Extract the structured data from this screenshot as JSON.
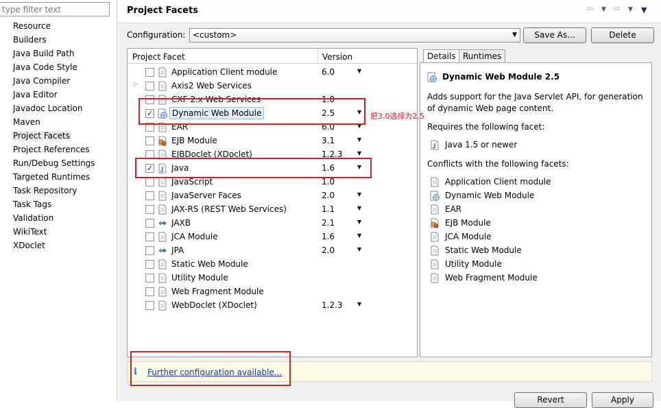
{
  "filter": {
    "placeholder": "type filter text"
  },
  "nav": {
    "items": [
      "Resource",
      "Builders",
      "Java Build Path",
      "Java Code Style",
      "Java Compiler",
      "Java Editor",
      "Javadoc Location",
      "Maven",
      "Project Facets",
      "Project References",
      "Run/Debug Settings",
      "Targeted Runtimes",
      "Task Repository",
      "Task Tags",
      "Validation",
      "WikiText",
      "XDoclet"
    ],
    "selected": "Project Facets"
  },
  "page": {
    "title": "Project Facets",
    "back_icon": "arrow-left-icon",
    "forward_icon": "arrow-right-icon"
  },
  "configuration": {
    "label": "Configuration:",
    "value": "<custom>",
    "save_as_label": "Save As...",
    "delete_label": "Delete"
  },
  "facets": {
    "headers": {
      "facet": "Project Facet",
      "version": "Version"
    },
    "rows": [
      {
        "name": "Application Client module",
        "version": "6.0",
        "checked": false,
        "icon": "page-icon",
        "dropdown": true,
        "expandable": false
      },
      {
        "name": "Axis2 Web Services",
        "version": "",
        "checked": false,
        "icon": "page-icon",
        "dropdown": false,
        "expandable": true
      },
      {
        "name": "CXF 2.x Web Services",
        "version": "1.0",
        "checked": false,
        "icon": "page-icon",
        "dropdown": false,
        "expandable": false
      },
      {
        "name": "Dynamic Web Module",
        "version": "2.5",
        "checked": true,
        "icon": "globe-page-icon",
        "dropdown": true,
        "expandable": false
      },
      {
        "name": "EAR",
        "version": "6.0",
        "checked": false,
        "icon": "page-icon",
        "dropdown": true,
        "expandable": false
      },
      {
        "name": "EJB Module",
        "version": "3.1",
        "checked": false,
        "icon": "bean-icon",
        "dropdown": true,
        "expandable": false
      },
      {
        "name": "EJBDoclet (XDoclet)",
        "version": "1.2.3",
        "checked": false,
        "icon": "page-icon",
        "dropdown": true,
        "expandable": false
      },
      {
        "name": "Java",
        "version": "1.6",
        "checked": true,
        "icon": "java-icon",
        "dropdown": true,
        "expandable": false
      },
      {
        "name": "JavaScript",
        "version": "1.0",
        "checked": false,
        "icon": "page-icon",
        "dropdown": false,
        "expandable": false
      },
      {
        "name": "JavaServer Faces",
        "version": "2.0",
        "checked": false,
        "icon": "page-icon",
        "dropdown": true,
        "expandable": false
      },
      {
        "name": "JAX-RS (REST Web Services)",
        "version": "1.1",
        "checked": false,
        "icon": "page-icon",
        "dropdown": true,
        "expandable": false
      },
      {
        "name": "JAXB",
        "version": "2.1",
        "checked": false,
        "icon": "arrows-icon",
        "dropdown": true,
        "expandable": false
      },
      {
        "name": "JCA Module",
        "version": "1.6",
        "checked": false,
        "icon": "page-icon",
        "dropdown": true,
        "expandable": false
      },
      {
        "name": "JPA",
        "version": "2.0",
        "checked": false,
        "icon": "arrows-icon",
        "dropdown": true,
        "expandable": false
      },
      {
        "name": "Static Web Module",
        "version": "",
        "checked": false,
        "icon": "page-icon",
        "dropdown": false,
        "expandable": false
      },
      {
        "name": "Utility Module",
        "version": "",
        "checked": false,
        "icon": "page-icon",
        "dropdown": false,
        "expandable": false
      },
      {
        "name": "Web Fragment Module",
        "version": "",
        "checked": false,
        "icon": "page-icon",
        "dropdown": false,
        "expandable": false
      },
      {
        "name": "WebDoclet (XDoclet)",
        "version": "1.2.3",
        "checked": false,
        "icon": "page-icon",
        "dropdown": true,
        "expandable": false
      }
    ]
  },
  "details": {
    "tabs": {
      "details": "Details",
      "runtimes": "Runtimes"
    },
    "title": "Dynamic Web Module 2.5",
    "description_line1": "Adds support for the Java Servlet API, for generation",
    "description_line2": "of dynamic Web page content.",
    "requires_label": "Requires the following facet:",
    "requires": [
      {
        "name": "Java 1.5 or newer",
        "icon": "java-icon"
      }
    ],
    "conflicts_label": "Conflicts with the following facets:",
    "conflicts": [
      {
        "name": "Application Client module",
        "icon": "page-icon"
      },
      {
        "name": "Dynamic Web Module",
        "icon": "globe-page-icon"
      },
      {
        "name": "EAR",
        "icon": "page-icon"
      },
      {
        "name": "EJB Module",
        "icon": "bean-icon"
      },
      {
        "name": "JCA Module",
        "icon": "page-icon"
      },
      {
        "name": "Static Web Module",
        "icon": "page-icon"
      },
      {
        "name": "Utility Module",
        "icon": "page-icon"
      },
      {
        "name": "Web Fragment Module",
        "icon": "page-icon"
      }
    ]
  },
  "info": {
    "icon": "info-icon",
    "symbol": "i",
    "link": "Further configuration available..."
  },
  "annotation": {
    "text": "把3.0选择为2.5",
    "color": "#d41f1f"
  },
  "footer": {
    "revert_label": "Revert",
    "apply_label": "Apply"
  }
}
